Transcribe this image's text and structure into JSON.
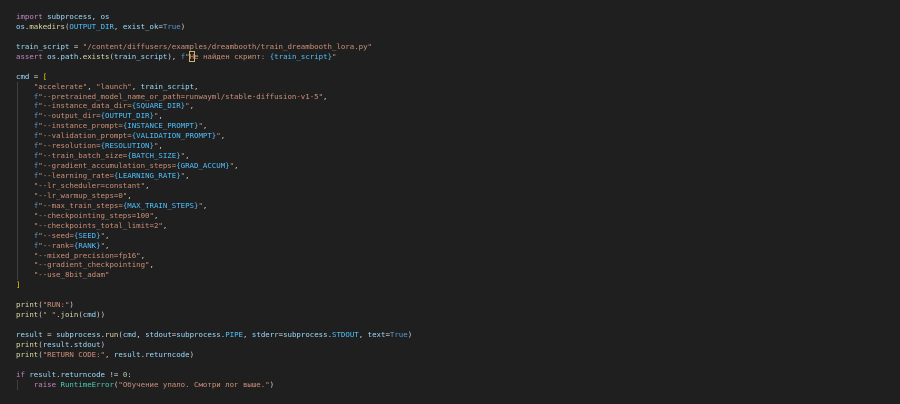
{
  "code_lines": [
    [
      [
        "kw",
        "import"
      ],
      [
        "pun",
        " "
      ],
      [
        "var",
        "subprocess"
      ],
      [
        "pun",
        ", "
      ],
      [
        "var",
        "os"
      ]
    ],
    [
      [
        "var",
        "os"
      ],
      [
        "pun",
        "."
      ],
      [
        "fn",
        "makedirs"
      ],
      [
        "pun",
        "("
      ],
      [
        "const",
        "OUTPUT_DIR"
      ],
      [
        "pun",
        ", "
      ],
      [
        "var",
        "exist_ok"
      ],
      [
        "op",
        "="
      ],
      [
        "bool",
        "True"
      ],
      [
        "pun",
        ")"
      ]
    ],
    [],
    [
      [
        "var",
        "train_script"
      ],
      [
        "op",
        " = "
      ],
      [
        "str",
        "\"/content/diffusers/examples/dreambooth/train_dreambooth_lora.py\""
      ]
    ],
    [
      [
        "kw",
        "assert"
      ],
      [
        "pun",
        " "
      ],
      [
        "var",
        "os"
      ],
      [
        "pun",
        "."
      ],
      [
        "var",
        "path"
      ],
      [
        "pun",
        "."
      ],
      [
        "fn",
        "exists"
      ],
      [
        "pun",
        "("
      ],
      [
        "var",
        "train_script"
      ],
      [
        "pun",
        "), "
      ],
      [
        "fpre",
        "f"
      ],
      [
        "str",
        "\""
      ],
      [
        "sel",
        "Н"
      ],
      [
        "str",
        "е найден скрипт: "
      ],
      [
        "const",
        "{train_script}"
      ],
      [
        "str",
        "\""
      ]
    ],
    [],
    [
      [
        "var",
        "cmd"
      ],
      [
        "op",
        " = "
      ],
      [
        "br",
        "["
      ]
    ],
    [
      [
        "pun",
        "    "
      ],
      [
        "str",
        "\"accelerate\""
      ],
      [
        "pun",
        ", "
      ],
      [
        "str",
        "\"launch\""
      ],
      [
        "pun",
        ", "
      ],
      [
        "var",
        "train_script"
      ],
      [
        "pun",
        ","
      ]
    ],
    [
      [
        "pun",
        "    "
      ],
      [
        "fpre",
        "f"
      ],
      [
        "str",
        "\"--pretrained_model_name_or_path=runwayml/stable-diffusion-v1-5\""
      ],
      [
        "pun",
        ","
      ]
    ],
    [
      [
        "pun",
        "    "
      ],
      [
        "fpre",
        "f"
      ],
      [
        "str",
        "\"--instance_data_dir="
      ],
      [
        "const",
        "{SQUARE_DIR}"
      ],
      [
        "str",
        "\""
      ],
      [
        "pun",
        ","
      ]
    ],
    [
      [
        "pun",
        "    "
      ],
      [
        "fpre",
        "f"
      ],
      [
        "str",
        "\"--output_dir="
      ],
      [
        "const",
        "{OUTPUT_DIR}"
      ],
      [
        "str",
        "\""
      ],
      [
        "pun",
        ","
      ]
    ],
    [
      [
        "pun",
        "    "
      ],
      [
        "fpre",
        "f"
      ],
      [
        "str",
        "\"--instance_prompt="
      ],
      [
        "const",
        "{INSTANCE_PROMPT}"
      ],
      [
        "str",
        "\""
      ],
      [
        "pun",
        ","
      ]
    ],
    [
      [
        "pun",
        "    "
      ],
      [
        "fpre",
        "f"
      ],
      [
        "str",
        "\"--validation_prompt="
      ],
      [
        "const",
        "{VALIDATION_PROMPT}"
      ],
      [
        "str",
        "\""
      ],
      [
        "pun",
        ","
      ]
    ],
    [
      [
        "pun",
        "    "
      ],
      [
        "fpre",
        "f"
      ],
      [
        "str",
        "\"--resolution="
      ],
      [
        "const",
        "{RESOLUTION}"
      ],
      [
        "str",
        "\""
      ],
      [
        "pun",
        ","
      ]
    ],
    [
      [
        "pun",
        "    "
      ],
      [
        "fpre",
        "f"
      ],
      [
        "str",
        "\"--train_batch_size="
      ],
      [
        "const",
        "{BATCH_SIZE}"
      ],
      [
        "str",
        "\""
      ],
      [
        "pun",
        ","
      ]
    ],
    [
      [
        "pun",
        "    "
      ],
      [
        "fpre",
        "f"
      ],
      [
        "str",
        "\"--gradient_accumulation_steps="
      ],
      [
        "const",
        "{GRAD_ACCUM}"
      ],
      [
        "str",
        "\""
      ],
      [
        "pun",
        ","
      ]
    ],
    [
      [
        "pun",
        "    "
      ],
      [
        "fpre",
        "f"
      ],
      [
        "str",
        "\"--learning_rate="
      ],
      [
        "const",
        "{LEARNING_RATE}"
      ],
      [
        "str",
        "\""
      ],
      [
        "pun",
        ","
      ]
    ],
    [
      [
        "pun",
        "    "
      ],
      [
        "str",
        "\"--lr_scheduler=constant\""
      ],
      [
        "pun",
        ","
      ]
    ],
    [
      [
        "pun",
        "    "
      ],
      [
        "str",
        "\"--lr_warmup_steps=0\""
      ],
      [
        "pun",
        ","
      ]
    ],
    [
      [
        "pun",
        "    "
      ],
      [
        "fpre",
        "f"
      ],
      [
        "str",
        "\"--max_train_steps="
      ],
      [
        "const",
        "{MAX_TRAIN_STEPS}"
      ],
      [
        "str",
        "\""
      ],
      [
        "pun",
        ","
      ]
    ],
    [
      [
        "pun",
        "    "
      ],
      [
        "str",
        "\"--checkpointing_steps=100\""
      ],
      [
        "pun",
        ","
      ]
    ],
    [
      [
        "pun",
        "    "
      ],
      [
        "str",
        "\"--checkpoints_total_limit=2\""
      ],
      [
        "pun",
        ","
      ]
    ],
    [
      [
        "pun",
        "    "
      ],
      [
        "fpre",
        "f"
      ],
      [
        "str",
        "\"--seed="
      ],
      [
        "const",
        "{SEED}"
      ],
      [
        "str",
        "\""
      ],
      [
        "pun",
        ","
      ]
    ],
    [
      [
        "pun",
        "    "
      ],
      [
        "fpre",
        "f"
      ],
      [
        "str",
        "\"--rank="
      ],
      [
        "const",
        "{RANK}"
      ],
      [
        "str",
        "\""
      ],
      [
        "pun",
        ","
      ]
    ],
    [
      [
        "pun",
        "    "
      ],
      [
        "str",
        "\"--mixed_precision=fp16\""
      ],
      [
        "pun",
        ","
      ]
    ],
    [
      [
        "pun",
        "    "
      ],
      [
        "str",
        "\"--gradient_checkpointing\""
      ],
      [
        "pun",
        ","
      ]
    ],
    [
      [
        "pun",
        "    "
      ],
      [
        "str",
        "\"--use_8bit_adam\""
      ]
    ],
    [
      [
        "br",
        "]"
      ]
    ],
    [],
    [
      [
        "fn",
        "print"
      ],
      [
        "pun",
        "("
      ],
      [
        "str",
        "\"RUN:\""
      ],
      [
        "pun",
        ")"
      ]
    ],
    [
      [
        "fn",
        "print"
      ],
      [
        "pun",
        "("
      ],
      [
        "str",
        "\" \""
      ],
      [
        "pun",
        "."
      ],
      [
        "fn",
        "join"
      ],
      [
        "pun",
        "("
      ],
      [
        "var",
        "cmd"
      ],
      [
        "pun",
        "))"
      ]
    ],
    [],
    [
      [
        "var",
        "result"
      ],
      [
        "op",
        " = "
      ],
      [
        "var",
        "subprocess"
      ],
      [
        "pun",
        "."
      ],
      [
        "fn",
        "run"
      ],
      [
        "pun",
        "("
      ],
      [
        "var",
        "cmd"
      ],
      [
        "pun",
        ", "
      ],
      [
        "var",
        "stdout"
      ],
      [
        "op",
        "="
      ],
      [
        "var",
        "subprocess"
      ],
      [
        "pun",
        "."
      ],
      [
        "const",
        "PIPE"
      ],
      [
        "pun",
        ", "
      ],
      [
        "var",
        "stderr"
      ],
      [
        "op",
        "="
      ],
      [
        "var",
        "subprocess"
      ],
      [
        "pun",
        "."
      ],
      [
        "const",
        "STDOUT"
      ],
      [
        "pun",
        ", "
      ],
      [
        "var",
        "text"
      ],
      [
        "op",
        "="
      ],
      [
        "bool",
        "True"
      ],
      [
        "pun",
        ")"
      ]
    ],
    [
      [
        "fn",
        "print"
      ],
      [
        "pun",
        "("
      ],
      [
        "var",
        "result"
      ],
      [
        "pun",
        "."
      ],
      [
        "var",
        "stdout"
      ],
      [
        "pun",
        ")"
      ]
    ],
    [
      [
        "fn",
        "print"
      ],
      [
        "pun",
        "("
      ],
      [
        "str",
        "\"RETURN CODE:\""
      ],
      [
        "pun",
        ", "
      ],
      [
        "var",
        "result"
      ],
      [
        "pun",
        "."
      ],
      [
        "var",
        "returncode"
      ],
      [
        "pun",
        ")"
      ]
    ],
    [],
    [
      [
        "kw",
        "if"
      ],
      [
        "pun",
        " "
      ],
      [
        "var",
        "result"
      ],
      [
        "pun",
        "."
      ],
      [
        "var",
        "returncode"
      ],
      [
        "op",
        " != "
      ],
      [
        "num",
        "0"
      ],
      [
        "pun",
        ":"
      ]
    ],
    [
      [
        "pun",
        "    "
      ],
      [
        "kw",
        "raise"
      ],
      [
        "pun",
        " "
      ],
      [
        "cls",
        "RuntimeError"
      ],
      [
        "pun",
        "("
      ],
      [
        "str",
        "\"Обучение упало. Смотри лог выше.\""
      ],
      [
        "pun",
        ")"
      ]
    ]
  ],
  "indent_guides": [
    7,
    26,
    37,
    37
  ]
}
